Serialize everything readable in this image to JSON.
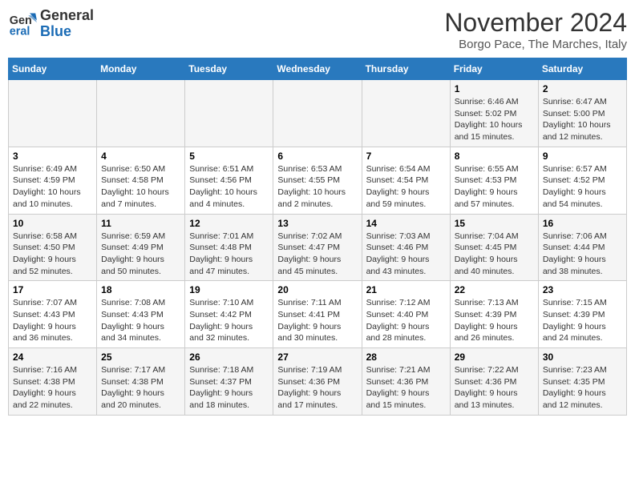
{
  "logo": {
    "line1": "General",
    "line2": "Blue"
  },
  "title": "November 2024",
  "subtitle": "Borgo Pace, The Marches, Italy",
  "days_header": [
    "Sunday",
    "Monday",
    "Tuesday",
    "Wednesday",
    "Thursday",
    "Friday",
    "Saturday"
  ],
  "weeks": [
    [
      {
        "day": "",
        "info": ""
      },
      {
        "day": "",
        "info": ""
      },
      {
        "day": "",
        "info": ""
      },
      {
        "day": "",
        "info": ""
      },
      {
        "day": "",
        "info": ""
      },
      {
        "day": "1",
        "info": "Sunrise: 6:46 AM\nSunset: 5:02 PM\nDaylight: 10 hours and 15 minutes."
      },
      {
        "day": "2",
        "info": "Sunrise: 6:47 AM\nSunset: 5:00 PM\nDaylight: 10 hours and 12 minutes."
      }
    ],
    [
      {
        "day": "3",
        "info": "Sunrise: 6:49 AM\nSunset: 4:59 PM\nDaylight: 10 hours and 10 minutes."
      },
      {
        "day": "4",
        "info": "Sunrise: 6:50 AM\nSunset: 4:58 PM\nDaylight: 10 hours and 7 minutes."
      },
      {
        "day": "5",
        "info": "Sunrise: 6:51 AM\nSunset: 4:56 PM\nDaylight: 10 hours and 4 minutes."
      },
      {
        "day": "6",
        "info": "Sunrise: 6:53 AM\nSunset: 4:55 PM\nDaylight: 10 hours and 2 minutes."
      },
      {
        "day": "7",
        "info": "Sunrise: 6:54 AM\nSunset: 4:54 PM\nDaylight: 9 hours and 59 minutes."
      },
      {
        "day": "8",
        "info": "Sunrise: 6:55 AM\nSunset: 4:53 PM\nDaylight: 9 hours and 57 minutes."
      },
      {
        "day": "9",
        "info": "Sunrise: 6:57 AM\nSunset: 4:52 PM\nDaylight: 9 hours and 54 minutes."
      }
    ],
    [
      {
        "day": "10",
        "info": "Sunrise: 6:58 AM\nSunset: 4:50 PM\nDaylight: 9 hours and 52 minutes."
      },
      {
        "day": "11",
        "info": "Sunrise: 6:59 AM\nSunset: 4:49 PM\nDaylight: 9 hours and 50 minutes."
      },
      {
        "day": "12",
        "info": "Sunrise: 7:01 AM\nSunset: 4:48 PM\nDaylight: 9 hours and 47 minutes."
      },
      {
        "day": "13",
        "info": "Sunrise: 7:02 AM\nSunset: 4:47 PM\nDaylight: 9 hours and 45 minutes."
      },
      {
        "day": "14",
        "info": "Sunrise: 7:03 AM\nSunset: 4:46 PM\nDaylight: 9 hours and 43 minutes."
      },
      {
        "day": "15",
        "info": "Sunrise: 7:04 AM\nSunset: 4:45 PM\nDaylight: 9 hours and 40 minutes."
      },
      {
        "day": "16",
        "info": "Sunrise: 7:06 AM\nSunset: 4:44 PM\nDaylight: 9 hours and 38 minutes."
      }
    ],
    [
      {
        "day": "17",
        "info": "Sunrise: 7:07 AM\nSunset: 4:43 PM\nDaylight: 9 hours and 36 minutes."
      },
      {
        "day": "18",
        "info": "Sunrise: 7:08 AM\nSunset: 4:43 PM\nDaylight: 9 hours and 34 minutes."
      },
      {
        "day": "19",
        "info": "Sunrise: 7:10 AM\nSunset: 4:42 PM\nDaylight: 9 hours and 32 minutes."
      },
      {
        "day": "20",
        "info": "Sunrise: 7:11 AM\nSunset: 4:41 PM\nDaylight: 9 hours and 30 minutes."
      },
      {
        "day": "21",
        "info": "Sunrise: 7:12 AM\nSunset: 4:40 PM\nDaylight: 9 hours and 28 minutes."
      },
      {
        "day": "22",
        "info": "Sunrise: 7:13 AM\nSunset: 4:39 PM\nDaylight: 9 hours and 26 minutes."
      },
      {
        "day": "23",
        "info": "Sunrise: 7:15 AM\nSunset: 4:39 PM\nDaylight: 9 hours and 24 minutes."
      }
    ],
    [
      {
        "day": "24",
        "info": "Sunrise: 7:16 AM\nSunset: 4:38 PM\nDaylight: 9 hours and 22 minutes."
      },
      {
        "day": "25",
        "info": "Sunrise: 7:17 AM\nSunset: 4:38 PM\nDaylight: 9 hours and 20 minutes."
      },
      {
        "day": "26",
        "info": "Sunrise: 7:18 AM\nSunset: 4:37 PM\nDaylight: 9 hours and 18 minutes."
      },
      {
        "day": "27",
        "info": "Sunrise: 7:19 AM\nSunset: 4:36 PM\nDaylight: 9 hours and 17 minutes."
      },
      {
        "day": "28",
        "info": "Sunrise: 7:21 AM\nSunset: 4:36 PM\nDaylight: 9 hours and 15 minutes."
      },
      {
        "day": "29",
        "info": "Sunrise: 7:22 AM\nSunset: 4:36 PM\nDaylight: 9 hours and 13 minutes."
      },
      {
        "day": "30",
        "info": "Sunrise: 7:23 AM\nSunset: 4:35 PM\nDaylight: 9 hours and 12 minutes."
      }
    ]
  ]
}
